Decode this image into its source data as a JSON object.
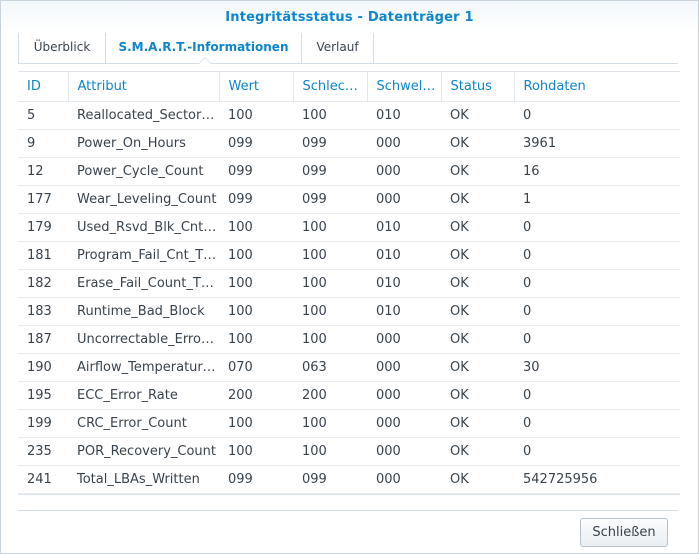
{
  "window": {
    "title": "Integritätsstatus - Datenträger 1"
  },
  "tabs": [
    {
      "label": "Überblick",
      "active": false
    },
    {
      "label": "S.M.A.R.T.-Informationen",
      "active": true
    },
    {
      "label": "Verlauf",
      "active": false
    }
  ],
  "table": {
    "columns": [
      "ID",
      "Attribut",
      "Wert",
      "Schlec…",
      "Schwel…",
      "Status",
      "Rohdaten"
    ],
    "rows": [
      [
        "5",
        "Reallocated_Sector_…",
        "100",
        "100",
        "010",
        "OK",
        "0"
      ],
      [
        "9",
        "Power_On_Hours",
        "099",
        "099",
        "000",
        "OK",
        "3961"
      ],
      [
        "12",
        "Power_Cycle_Count",
        "099",
        "099",
        "000",
        "OK",
        "16"
      ],
      [
        "177",
        "Wear_Leveling_Count",
        "099",
        "099",
        "000",
        "OK",
        "1"
      ],
      [
        "179",
        "Used_Rsvd_Blk_Cnt…",
        "100",
        "100",
        "010",
        "OK",
        "0"
      ],
      [
        "181",
        "Program_Fail_Cnt_T…",
        "100",
        "100",
        "010",
        "OK",
        "0"
      ],
      [
        "182",
        "Erase_Fail_Count_T…",
        "100",
        "100",
        "010",
        "OK",
        "0"
      ],
      [
        "183",
        "Runtime_Bad_Block",
        "100",
        "100",
        "010",
        "OK",
        "0"
      ],
      [
        "187",
        "Uncorrectable_Error…",
        "100",
        "100",
        "000",
        "OK",
        "0"
      ],
      [
        "190",
        "Airflow_Temperature…",
        "070",
        "063",
        "000",
        "OK",
        "30"
      ],
      [
        "195",
        "ECC_Error_Rate",
        "200",
        "200",
        "000",
        "OK",
        "0"
      ],
      [
        "199",
        "CRC_Error_Count",
        "100",
        "100",
        "000",
        "OK",
        "0"
      ],
      [
        "235",
        "POR_Recovery_Count",
        "100",
        "100",
        "000",
        "OK",
        "0"
      ],
      [
        "241",
        "Total_LBAs_Written",
        "099",
        "099",
        "000",
        "OK",
        "542725956"
      ]
    ]
  },
  "footer": {
    "close_label": "Schließen"
  },
  "colors": {
    "accent": "#0e86ca",
    "text": "#39434d",
    "border": "#d5dde4"
  }
}
